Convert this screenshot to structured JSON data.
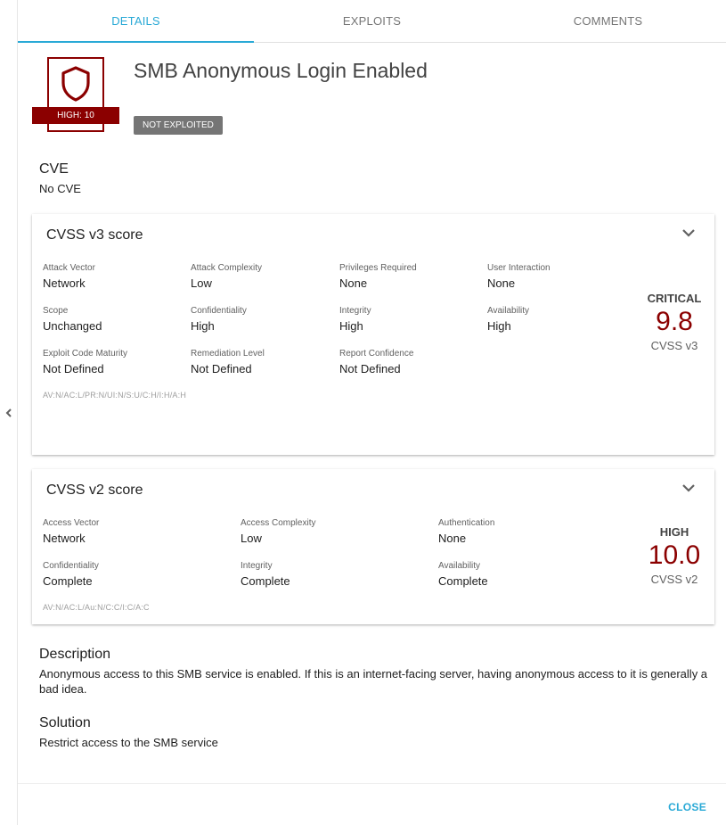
{
  "tabs": [
    "DETAILS",
    "EXPLOITS",
    "COMMENTS"
  ],
  "header": {
    "severity_badge": "HIGH: 10",
    "title": "SMB Anonymous Login Enabled",
    "status_chip": "NOT EXPLOITED"
  },
  "cve": {
    "heading": "CVE",
    "value": "No CVE"
  },
  "cvss_v3": {
    "title": "CVSS v3 score",
    "metrics": [
      {
        "label": "Attack Vector",
        "value": "Network"
      },
      {
        "label": "Attack Complexity",
        "value": "Low"
      },
      {
        "label": "Privileges Required",
        "value": "None"
      },
      {
        "label": "User Interaction",
        "value": "None"
      },
      {
        "label": "Scope",
        "value": "Unchanged"
      },
      {
        "label": "Confidentiality",
        "value": "High"
      },
      {
        "label": "Integrity",
        "value": "High"
      },
      {
        "label": "Availability",
        "value": "High"
      },
      {
        "label": "Exploit Code Maturity",
        "value": "Not Defined"
      },
      {
        "label": "Remediation Level",
        "value": "Not Defined"
      },
      {
        "label": "Report Confidence",
        "value": "Not Defined"
      }
    ],
    "vector": "AV:N/AC:L/PR:N/UI:N/S:U/C:H/I:H/A:H",
    "severity": "CRITICAL",
    "score": "9.8",
    "version": "CVSS v3"
  },
  "cvss_v2": {
    "title": "CVSS v2 score",
    "metrics": [
      {
        "label": "Access Vector",
        "value": "Network"
      },
      {
        "label": "Access Complexity",
        "value": "Low"
      },
      {
        "label": "Authentication",
        "value": "None"
      },
      {
        "label": "Confidentiality",
        "value": "Complete"
      },
      {
        "label": "Integrity",
        "value": "Complete"
      },
      {
        "label": "Availability",
        "value": "Complete"
      }
    ],
    "vector": "AV:N/AC:L/Au:N/C:C/I:C/A:C",
    "severity": "HIGH",
    "score": "10.0",
    "version": "CVSS v2"
  },
  "description": {
    "heading": "Description",
    "text": "Anonymous access to this SMB service is enabled. If this is an internet-facing server, having anonymous access to it is generally a bad idea."
  },
  "solution": {
    "heading": "Solution",
    "text": "Restrict access to the SMB service"
  },
  "footer": {
    "close_label": "CLOSE"
  },
  "colors": {
    "accent": "#29a9d6",
    "high_severity": "#8b0000",
    "chip_gray": "#757575"
  },
  "icons": [
    "chevron-left-icon",
    "shield-icon",
    "chevron-down-icon"
  ]
}
